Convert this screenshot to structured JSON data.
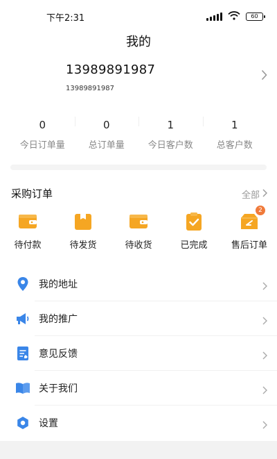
{
  "status_bar": {
    "time": "下午2:31",
    "battery": "60"
  },
  "header": {
    "title": "我的"
  },
  "profile": {
    "phone_main": "13989891987",
    "phone_sub": "13989891987"
  },
  "stats": [
    {
      "value": "0",
      "label": "今日订单量"
    },
    {
      "value": "0",
      "label": "总订单量"
    },
    {
      "value": "1",
      "label": "今日客户数"
    },
    {
      "value": "1",
      "label": "总客户数"
    }
  ],
  "orders": {
    "title": "采购订单",
    "all_label": "全部",
    "items": [
      {
        "label": "待付款",
        "icon": "wallet-icon",
        "badge": ""
      },
      {
        "label": "待发货",
        "icon": "box-icon",
        "badge": ""
      },
      {
        "label": "待收货",
        "icon": "wallet-icon",
        "badge": ""
      },
      {
        "label": "已完成",
        "icon": "check-clipboard-icon",
        "badge": ""
      },
      {
        "label": "售后订单",
        "icon": "return-box-icon",
        "badge": "2"
      }
    ]
  },
  "menu": [
    {
      "label": "我的地址",
      "icon": "location-pin-icon"
    },
    {
      "label": "我的推广",
      "icon": "megaphone-icon"
    },
    {
      "label": "意见反馈",
      "icon": "edit-document-icon"
    },
    {
      "label": "关于我们",
      "icon": "book-icon"
    },
    {
      "label": "设置",
      "icon": "gear-icon"
    }
  ],
  "colors": {
    "accent_orange": "#F5A623",
    "icon_blue": "#3A86E8",
    "badge_orange": "#F07A3A",
    "muted_text": "#888888"
  }
}
